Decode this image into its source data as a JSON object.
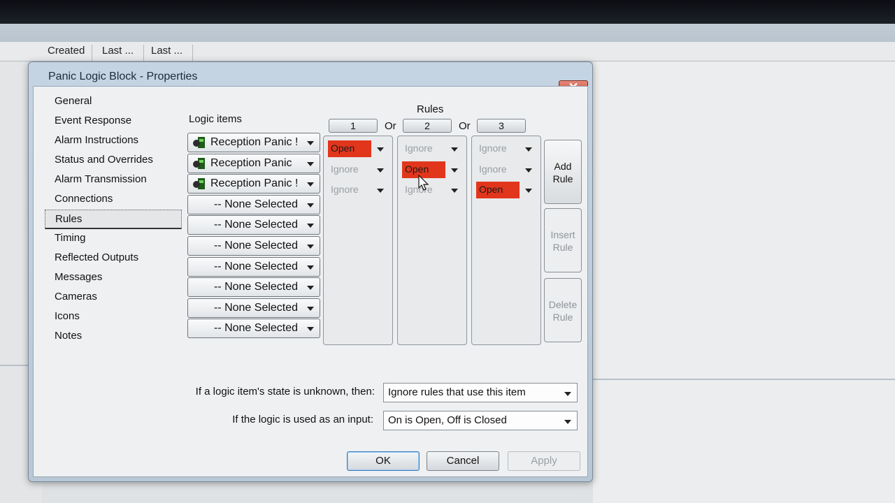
{
  "background": {
    "columns": [
      "Created",
      "Last ...",
      "Last ..."
    ]
  },
  "dialog": {
    "title": "Panic Logic Block - Properties",
    "close_label": "✕"
  },
  "nav": {
    "items": [
      "General",
      "Event Response",
      "Alarm Instructions",
      "Status and Overrides",
      "Alarm Transmission",
      "Connections",
      "Rules",
      "Timing",
      "Reflected Outputs",
      "Messages",
      "Cameras",
      "Icons",
      "Notes"
    ],
    "selected": "Rules"
  },
  "logic": {
    "label": "Logic items",
    "items": [
      "Reception Panic !",
      "Reception Panic",
      "Reception Panic !",
      "-- None Selected",
      "-- None Selected",
      "-- None Selected",
      "-- None Selected",
      "-- None Selected",
      "-- None Selected",
      "-- None Selected"
    ]
  },
  "rules": {
    "label": "Rules",
    "headers": [
      "1",
      "2",
      "3"
    ],
    "or_label": "Or",
    "columns": [
      [
        "Open",
        "Ignore",
        "Ignore"
      ],
      [
        "Ignore",
        "Open",
        "Ignore"
      ],
      [
        "Ignore",
        "Ignore",
        "Open"
      ]
    ],
    "open_color": "#e2361c"
  },
  "side_buttons": {
    "add": "Add Rule",
    "insert": "Insert Rule",
    "delete": "Delete Rule"
  },
  "options": {
    "unknown_label": "If a logic item's state is unknown, then:",
    "unknown_value": "Ignore rules that use this item",
    "input_label": "If the logic is used as an input:",
    "input_value": "On is Open, Off is Closed"
  },
  "buttons": {
    "ok": "OK",
    "cancel": "Cancel",
    "apply": "Apply"
  }
}
